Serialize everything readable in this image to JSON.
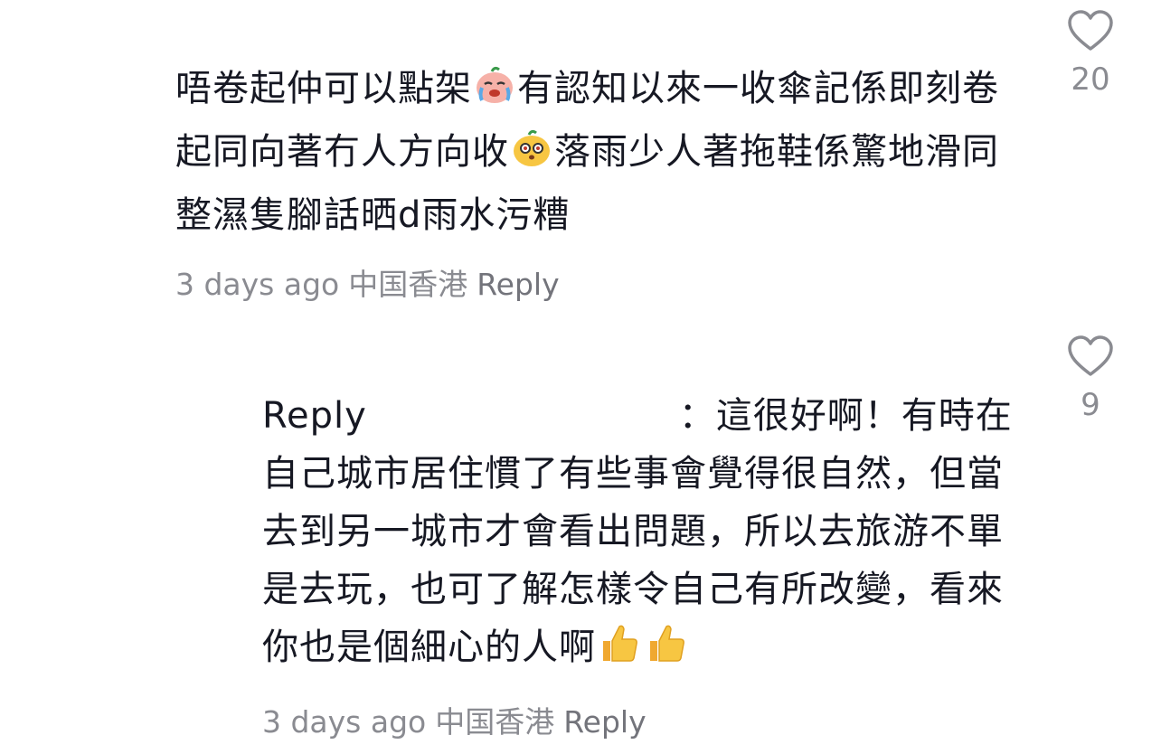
{
  "comments": [
    {
      "text_parts": [
        "唔卷起仲可以點架",
        "有認知以來一收傘記係即刻卷起同向著冇人方向收",
        "落雨少人著拖鞋係驚地滑同整濕隻腳話晒d雨水污糟"
      ],
      "emoji_1": "crying-face-emoji",
      "emoji_2": "surprised-face-emoji",
      "timestamp": "3 days ago",
      "location": "中国香港",
      "reply_label": "Reply",
      "likes": "20"
    },
    {
      "reply_prefix": "Reply",
      "text": "：這很好啊！有時在自己城市居住慣了有些事會覺得很自然，但當去到另一城市才會看出問題，所以去旅游不單是去玩，也可了解怎樣令自己有所改變，看來你也是個細心的人啊",
      "emoji_trailing": "thumbs-up-emoji",
      "timestamp": "3 days ago",
      "location": "中国香港",
      "reply_label": "Reply",
      "likes": "9"
    }
  ],
  "colors": {
    "text": "#161823",
    "meta": "#8a8b91",
    "emoji_yellow": "#f7c642",
    "emoji_pink": "#f4a3a3"
  },
  "icons": {
    "like": "heart-outline-icon"
  }
}
